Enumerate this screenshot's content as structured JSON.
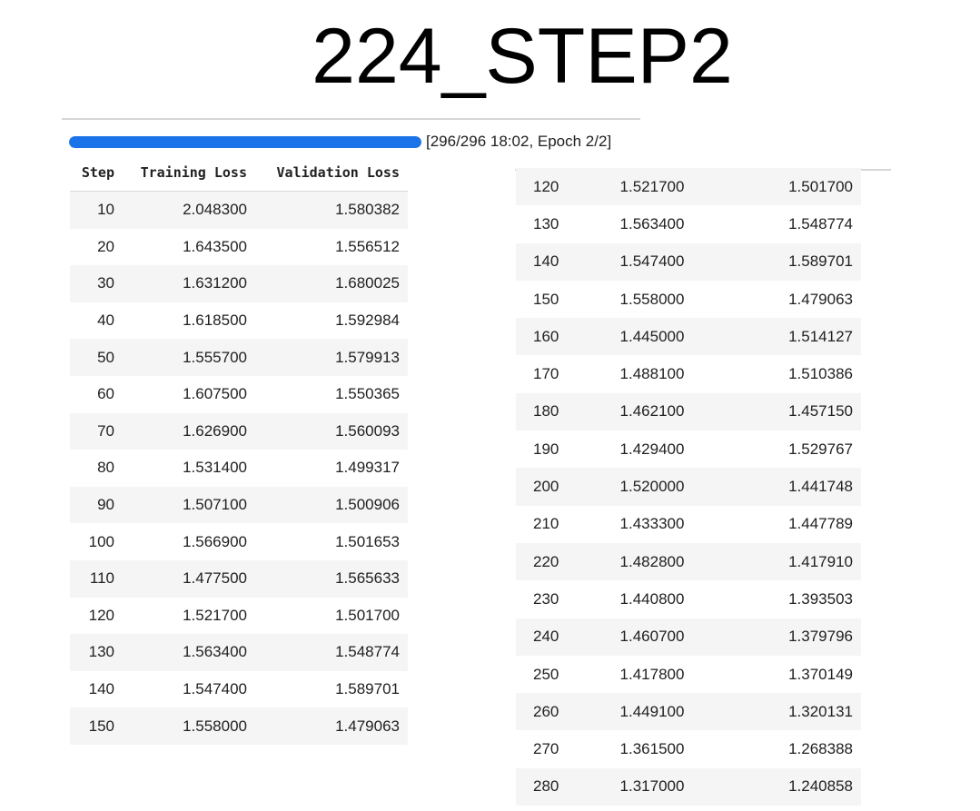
{
  "title": "224_STEP2",
  "progress": {
    "fraction": 1.0,
    "text": "[296/296 18:02, Epoch 2/2]"
  },
  "columns": [
    "Step",
    "Training Loss",
    "Validation Loss"
  ],
  "left_rows": [
    {
      "step": "10",
      "train": "2.048300",
      "val": "1.580382"
    },
    {
      "step": "20",
      "train": "1.643500",
      "val": "1.556512"
    },
    {
      "step": "30",
      "train": "1.631200",
      "val": "1.680025"
    },
    {
      "step": "40",
      "train": "1.618500",
      "val": "1.592984"
    },
    {
      "step": "50",
      "train": "1.555700",
      "val": "1.579913"
    },
    {
      "step": "60",
      "train": "1.607500",
      "val": "1.550365"
    },
    {
      "step": "70",
      "train": "1.626900",
      "val": "1.560093"
    },
    {
      "step": "80",
      "train": "1.531400",
      "val": "1.499317"
    },
    {
      "step": "90",
      "train": "1.507100",
      "val": "1.500906"
    },
    {
      "step": "100",
      "train": "1.566900",
      "val": "1.501653"
    },
    {
      "step": "110",
      "train": "1.477500",
      "val": "1.565633"
    },
    {
      "step": "120",
      "train": "1.521700",
      "val": "1.501700"
    },
    {
      "step": "130",
      "train": "1.563400",
      "val": "1.548774"
    },
    {
      "step": "140",
      "train": "1.547400",
      "val": "1.589701"
    },
    {
      "step": "150",
      "train": "1.558000",
      "val": "1.479063"
    }
  ],
  "right_rows": [
    {
      "step": "120",
      "train": "1.521700",
      "val": "1.501700"
    },
    {
      "step": "130",
      "train": "1.563400",
      "val": "1.548774"
    },
    {
      "step": "140",
      "train": "1.547400",
      "val": "1.589701"
    },
    {
      "step": "150",
      "train": "1.558000",
      "val": "1.479063"
    },
    {
      "step": "160",
      "train": "1.445000",
      "val": "1.514127"
    },
    {
      "step": "170",
      "train": "1.488100",
      "val": "1.510386"
    },
    {
      "step": "180",
      "train": "1.462100",
      "val": "1.457150"
    },
    {
      "step": "190",
      "train": "1.429400",
      "val": "1.529767"
    },
    {
      "step": "200",
      "train": "1.520000",
      "val": "1.441748"
    },
    {
      "step": "210",
      "train": "1.433300",
      "val": "1.447789"
    },
    {
      "step": "220",
      "train": "1.482800",
      "val": "1.417910"
    },
    {
      "step": "230",
      "train": "1.440800",
      "val": "1.393503"
    },
    {
      "step": "240",
      "train": "1.460700",
      "val": "1.379796"
    },
    {
      "step": "250",
      "train": "1.417800",
      "val": "1.370149"
    },
    {
      "step": "260",
      "train": "1.449100",
      "val": "1.320131"
    },
    {
      "step": "270",
      "train": "1.361500",
      "val": "1.268388"
    },
    {
      "step": "280",
      "train": "1.317000",
      "val": "1.240858"
    }
  ],
  "colors": {
    "progress": "#1a73e8",
    "row_stripe": "#f5f5f5"
  }
}
